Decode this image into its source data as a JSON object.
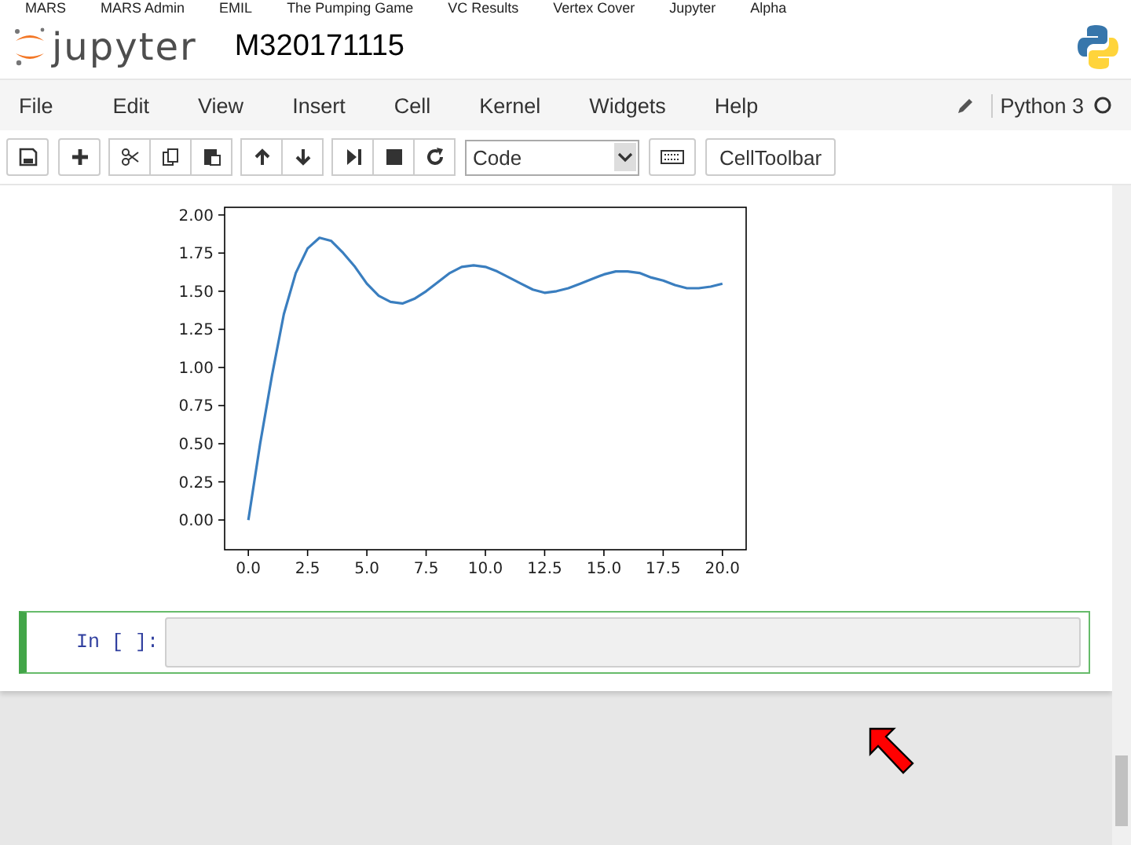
{
  "bookmarks": [
    "MARS",
    "MARS Admin",
    "EMIL",
    "The Pumping Game",
    "VC Results",
    "Vertex Cover",
    "Jupyter",
    "Alpha"
  ],
  "header": {
    "logo_text": "jupyter",
    "notebook_name": "M320171115"
  },
  "menu": [
    "File",
    "Edit",
    "View",
    "Insert",
    "Cell",
    "Kernel",
    "Widgets",
    "Help"
  ],
  "kernel": {
    "name": "Python 3"
  },
  "toolbar": {
    "cell_type": "Code",
    "cell_toolbar": "CellToolbar"
  },
  "output": {
    "chart_data": {
      "type": "line",
      "x": [
        0,
        0.5,
        1,
        1.5,
        2,
        2.5,
        3,
        3.5,
        4,
        4.5,
        5,
        5.5,
        6,
        6.5,
        7,
        7.5,
        8,
        8.5,
        9,
        9.5,
        10,
        10.5,
        11,
        11.5,
        12,
        12.5,
        13,
        13.5,
        14,
        14.5,
        15,
        15.5,
        16,
        16.5,
        17,
        17.5,
        18,
        18.5,
        19,
        19.5,
        20
      ],
      "series": [
        {
          "color": "#3a7ebf",
          "values": [
            0,
            0.5,
            0.95,
            1.35,
            1.62,
            1.78,
            1.85,
            1.83,
            1.75,
            1.66,
            1.55,
            1.47,
            1.43,
            1.42,
            1.45,
            1.5,
            1.56,
            1.62,
            1.66,
            1.67,
            1.66,
            1.63,
            1.59,
            1.55,
            1.51,
            1.49,
            1.5,
            1.52,
            1.55,
            1.58,
            1.61,
            1.63,
            1.63,
            1.62,
            1.59,
            1.57,
            1.54,
            1.52,
            1.52,
            1.53,
            1.55
          ]
        }
      ],
      "xlim": [
        -1,
        21
      ],
      "ylim": [
        -0.195,
        2.05
      ],
      "xticks": [
        {
          "value": 0,
          "label": "0.0"
        },
        {
          "value": 2.5,
          "label": "2.5"
        },
        {
          "value": 5,
          "label": "5.0"
        },
        {
          "value": 7.5,
          "label": "7.5"
        },
        {
          "value": 10,
          "label": "10.0"
        },
        {
          "value": 12.5,
          "label": "12.5"
        },
        {
          "value": 15,
          "label": "15.0"
        },
        {
          "value": 17.5,
          "label": "17.5"
        },
        {
          "value": 20,
          "label": "20.0"
        }
      ],
      "yticks": [
        {
          "value": 0,
          "label": "0.00"
        },
        {
          "value": 0.25,
          "label": "0.25"
        },
        {
          "value": 0.5,
          "label": "0.50"
        },
        {
          "value": 0.75,
          "label": "0.75"
        },
        {
          "value": 1,
          "label": "1.00"
        },
        {
          "value": 1.25,
          "label": "1.25"
        },
        {
          "value": 1.5,
          "label": "1.50"
        },
        {
          "value": 1.75,
          "label": "1.75"
        },
        {
          "value": 2,
          "label": "2.00"
        }
      ]
    }
  },
  "input_cell": {
    "prompt": "In [ ]:",
    "selected": true
  }
}
